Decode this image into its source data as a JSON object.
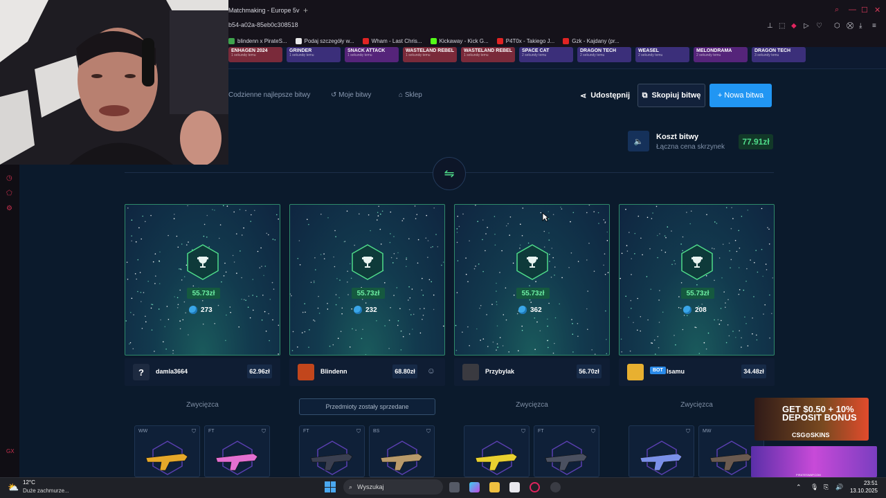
{
  "browser": {
    "tab_title": "Matchmaking - Europe 5v",
    "new_tab": "+",
    "url": "b54-a02a-85eb0c308518",
    "bookmarks": [
      {
        "label": "blindenn x PirateS...",
        "color": "#3fa34d"
      },
      {
        "label": "Podaj szczegóły w...",
        "color": "#e8e8e8"
      },
      {
        "label": "Wham - Last Chris...",
        "color": "#e02424"
      },
      {
        "label": "Kickaway - Kick G...",
        "color": "#53fc18"
      },
      {
        "label": "P4T0x - Takiego J...",
        "color": "#e02424"
      },
      {
        "label": "Gzk - Kajdany (pr...",
        "color": "#e02424"
      }
    ]
  },
  "recent_drops": [
    {
      "name": "ENHAGEN 2024",
      "time": "1 sekundę temu",
      "color": "#7a2a3a"
    },
    {
      "name": "GRINDER",
      "time": "1 sekundę temu",
      "color": "#3b2f7a"
    },
    {
      "name": "SNACK ATTACK",
      "time": "1 sekundę temu",
      "color": "#55247a"
    },
    {
      "name": "WASTELAND REBEL",
      "time": "1 sekundę temu",
      "color": "#7a2a3a"
    },
    {
      "name": "WASTELAND REBEL",
      "time": "1 sekundę temu",
      "color": "#7a2a3a"
    },
    {
      "name": "SPACE CAT",
      "time": "2 sekundy temu",
      "color": "#3b2f7a"
    },
    {
      "name": "DRAGON TECH",
      "time": "2 sekundy temu",
      "color": "#3b2f7a"
    },
    {
      "name": "WEASEL",
      "time": "2 sekundy temu",
      "color": "#3b2f7a"
    },
    {
      "name": "MELONDRAMA",
      "time": "2 sekundy temu",
      "color": "#55247a"
    },
    {
      "name": "DRAGON TECH",
      "time": "3 sekundy temu",
      "color": "#3b2f7a"
    }
  ],
  "nav": {
    "daily": "Codzienne najlepsze bitwy",
    "my": "Moje bitwy",
    "shop": "Sklep",
    "share": "Udostępnij",
    "copy": "Skopiuj bitwę",
    "new": "+ Nowa bitwa"
  },
  "cost": {
    "title": "Koszt bitwy",
    "subtitle": "Łączna cena skrzynek",
    "value": "77.91zł"
  },
  "players": [
    {
      "name": "damla3664",
      "value": "62.96zł",
      "prize": "55.73zł",
      "coins": "273",
      "status": "Zwycięzca",
      "sold": false,
      "bot": false,
      "avatar": "?",
      "avatar_color": "#1d2a40",
      "items": [
        {
          "cond": "WW",
          "color": "#e5a82a"
        },
        {
          "cond": "FT",
          "color": "#e46fd0"
        }
      ]
    },
    {
      "name": "Blindenn",
      "value": "68.80zł",
      "prize": "55.73zł",
      "coins": "232",
      "status": "Przedmioty zostały sprzedane",
      "sold": true,
      "bot": false,
      "avatar": "",
      "avatar_color": "#c2461c",
      "items": [
        {
          "cond": "FT",
          "color": "#3a3f50"
        },
        {
          "cond": "BS",
          "color": "#b89a6a"
        }
      ]
    },
    {
      "name": "Przybylak",
      "value": "56.70zł",
      "prize": "55.73zł",
      "coins": "362",
      "status": "Zwycięzca",
      "sold": false,
      "bot": false,
      "avatar": "",
      "avatar_color": "#3a3a40",
      "items": [
        {
          "cond": "",
          "color": "#e8d030"
        },
        {
          "cond": "FT",
          "color": "#4a5060"
        }
      ]
    },
    {
      "name": "Isamu",
      "value": "34.48zł",
      "prize": "55.73zł",
      "coins": "208",
      "status": "Zwycięzca",
      "sold": false,
      "bot": true,
      "bot_label": "BOT",
      "avatar": "",
      "avatar_color": "#e8b030",
      "items": [
        {
          "cond": "",
          "color": "#7a90e8"
        },
        {
          "cond": "MW",
          "color": "#6a5a50"
        }
      ]
    }
  ],
  "ad": {
    "text": "GET $0.50 + 10% DEPOSIT BONUS",
    "brand": "CSG⊙SKINS",
    "footer": "PIRATESWAP.COM"
  },
  "taskbar": {
    "temp": "12°C",
    "weather": "Duże zachmurze...",
    "search": "Wyszukaj",
    "time": "23:51",
    "date": "13.10.2025"
  }
}
